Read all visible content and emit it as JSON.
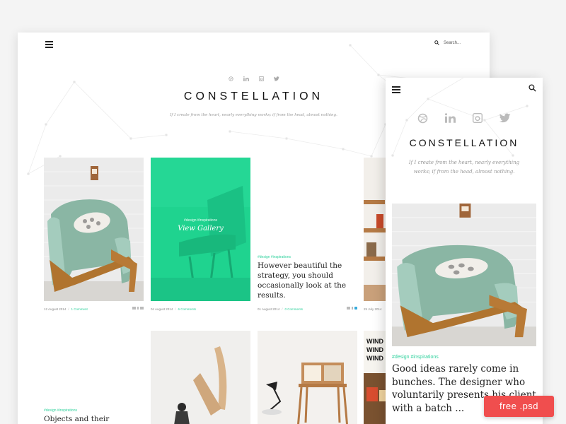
{
  "desktop": {
    "search": {
      "placeholder": "Search..."
    },
    "social_icons": [
      "dribbble-icon",
      "linkedin-icon",
      "instagram-icon",
      "twitter-icon"
    ],
    "title": "CONSTELLATION",
    "quote": "If I create from the heart, nearly everything works; if from the head, almost nothing.",
    "cards": [
      {
        "date": "12 August 2014",
        "comments": "1 Comment"
      },
      {
        "tags": "#design #inspirations",
        "label": "View Gallery",
        "date": "04 August 2014",
        "comments": "6 Comments"
      },
      {
        "tags": "#design #inspirations",
        "headline": "However beautiful the strategy, you should occasionally look at the results.",
        "date": "01 August 2014",
        "comments": "0 Comments"
      },
      {
        "date": "25 July 2014"
      }
    ],
    "row2": {
      "tags": "#design #inspirations",
      "headline": "Objects and their",
      "poster_text": "WIND\nWIND\nWIND"
    }
  },
  "mobile": {
    "social_icons": [
      "dribbble-icon",
      "linkedin-icon",
      "instagram-icon",
      "twitter-icon"
    ],
    "title": "CONSTELLATION",
    "quote": "If I create from the heart, nearly everything works; if from the head, almost nothing.",
    "tags": "#design #inspirations",
    "headline": "Good ideas rarely come in bunches. The designer who voluntarily presents his client with a batch ..."
  },
  "badge": {
    "label": "free .psd"
  },
  "colors": {
    "accent": "#2ed19c",
    "gallery_overlay": "#1fd38f",
    "badge": "#f04e4e",
    "twitter": "#34aadc"
  }
}
